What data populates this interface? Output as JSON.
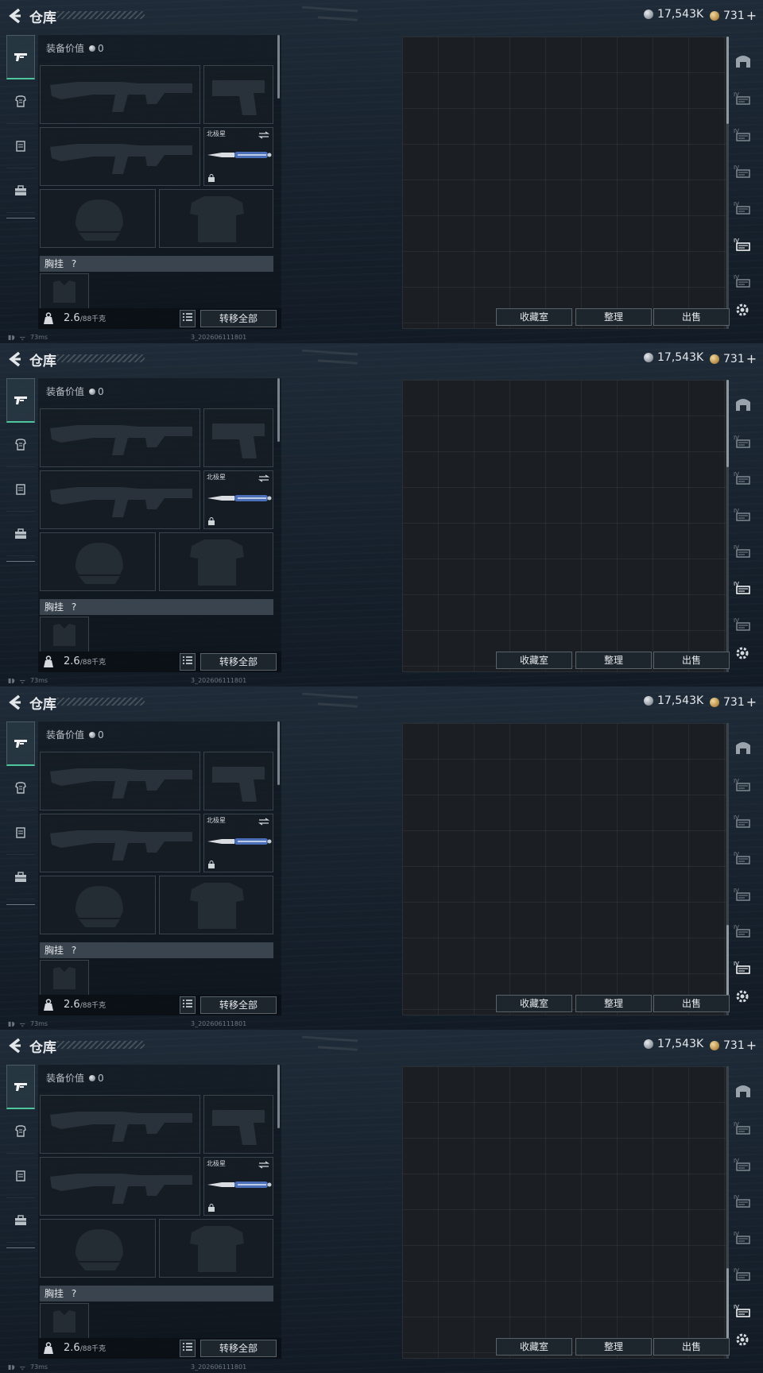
{
  "title": "仓库",
  "currency": {
    "silver": "17,543K",
    "gold": "731",
    "gold_add": "+"
  },
  "equip": {
    "value_label": "装备价值",
    "value": "0",
    "knife_name": "北极星",
    "section_chest": "胸挂",
    "section_help": "?",
    "weight": "2.6",
    "weight_max": "/88千克",
    "transfer_all": "转移全部"
  },
  "storage_buttons": {
    "collection": "收藏室",
    "organize": "整理",
    "sell": "出售"
  },
  "status": {
    "ping": "73ms",
    "build": "3_202606111801"
  },
  "tabs": [
    "weapon-icon",
    "armor-icon",
    "vest-icon",
    "backpack-icon"
  ],
  "side_icons": [
    "storage-main-icon",
    "storage-tab-1-icon",
    "storage-tab-2-icon",
    "storage-tab-3-icon",
    "storage-tab-4-icon",
    "storage-tab-5-icon",
    "storage-tab-6-icon"
  ],
  "frames": [
    {
      "active_side": 5
    },
    {
      "active_side": 5
    },
    {
      "active_side": 6
    },
    {
      "active_side": 6
    }
  ],
  "colors": {
    "accent": "#4ec59b",
    "background": "#18232f",
    "grid": "#1b1e22"
  }
}
